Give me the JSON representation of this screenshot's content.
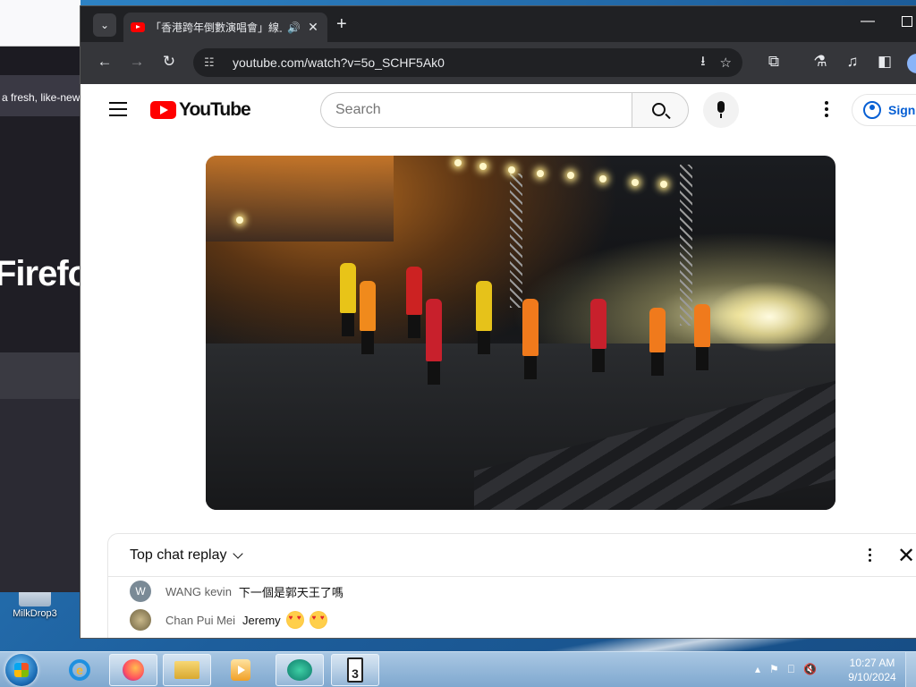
{
  "desktop": {
    "icon_label": "MilkDrop3"
  },
  "firefox_bg": {
    "tip_text": "a fresh, like-new",
    "brand_word": "Firefo"
  },
  "chrome": {
    "tab_title": "「香港跨年倒數演唱會」線上",
    "tab_audio_icon": "speaker-icon",
    "tab_close": "✕",
    "new_tab": "+",
    "url": "youtube.com/watch?v=5o_SCHF5Ak0"
  },
  "youtube": {
    "logo_text": "YouTube",
    "search_placeholder": "Search",
    "signin_label": "Sign",
    "chat": {
      "title": "Top chat replay",
      "close": "✕",
      "messages": [
        {
          "avatar_letter": "W",
          "avatar_color": "#7a8a96",
          "author": "WANG kevin",
          "text": "下一個是郭天王了嗎"
        },
        {
          "avatar_letter": "",
          "avatar_color": "#8a7a5a",
          "author": "Chan Pui Mei",
          "text": "Jeremy"
        }
      ]
    }
  },
  "taskbar": {
    "time": "10:27 AM",
    "date": "9/10/2024",
    "ie_glyph": "e",
    "milkdrop_glyph": "3"
  },
  "colors": {
    "youtube_red": "#ff0000",
    "link_blue": "#065fd4",
    "chrome_dark": "#202124"
  }
}
